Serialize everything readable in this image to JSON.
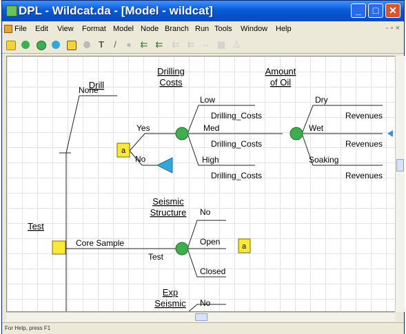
{
  "window": {
    "title": "DPL - Wildcat.da - [Model - wildcat]"
  },
  "menu": {
    "items": [
      "File",
      "Edit",
      "View",
      "Format",
      "Model",
      "Node",
      "Branch",
      "Run",
      "Tools",
      "Window",
      "Help"
    ]
  },
  "toolbar": {
    "icons": [
      "decision-node-icon",
      "chance-node-icon",
      "chance-node-alt-icon",
      "value-node-icon",
      "table-icon",
      "gray-node-icon",
      "text-tool-icon",
      "pen-tool-icon",
      "gray-tool-icon",
      "arrow-icon",
      "arrow-alt-icon",
      "disabled-icon",
      "disabled-icon",
      "disabled-icon",
      "disabled-icon",
      "disabled-icon"
    ]
  },
  "tree": {
    "headers": {
      "drill": "Drill",
      "drilling_costs": [
        "Drilling",
        "Costs"
      ],
      "amount_of_oil": [
        "Amount",
        "of Oil"
      ],
      "test": "Test",
      "seismic_structure": [
        "Seismic",
        "Structure"
      ],
      "exp_seismic": [
        "Exp",
        "Seismic"
      ]
    },
    "branches": {
      "none": "None",
      "yes": "Yes",
      "no": "No",
      "low": "Low",
      "med": "Med",
      "high": "High",
      "dry": "Dry",
      "wet": "Wet",
      "soaking": "Soaking",
      "core_sample": "Core Sample",
      "test_branch": "Test",
      "ss_no": "No",
      "open": "Open",
      "closed": "Closed",
      "exp_no": "No"
    },
    "values": {
      "drilling_costs_1": "Drilling_Costs",
      "drilling_costs_2": "Drilling_Costs",
      "drilling_costs_3": "Drilling_Costs",
      "revenues_1": "Revenues",
      "revenues_2": "Revenues",
      "revenues_3": "Revenues"
    },
    "node_labels": {
      "decision_a_1": "a",
      "decision_a_2": "a"
    }
  },
  "status": {
    "text": "For Help, press F1"
  },
  "colors": {
    "decision_node": "#f7e83a",
    "chance_node": "#3fae4f",
    "terminal_node": "#33a8d8",
    "title_bar": "#0a5bd6"
  }
}
